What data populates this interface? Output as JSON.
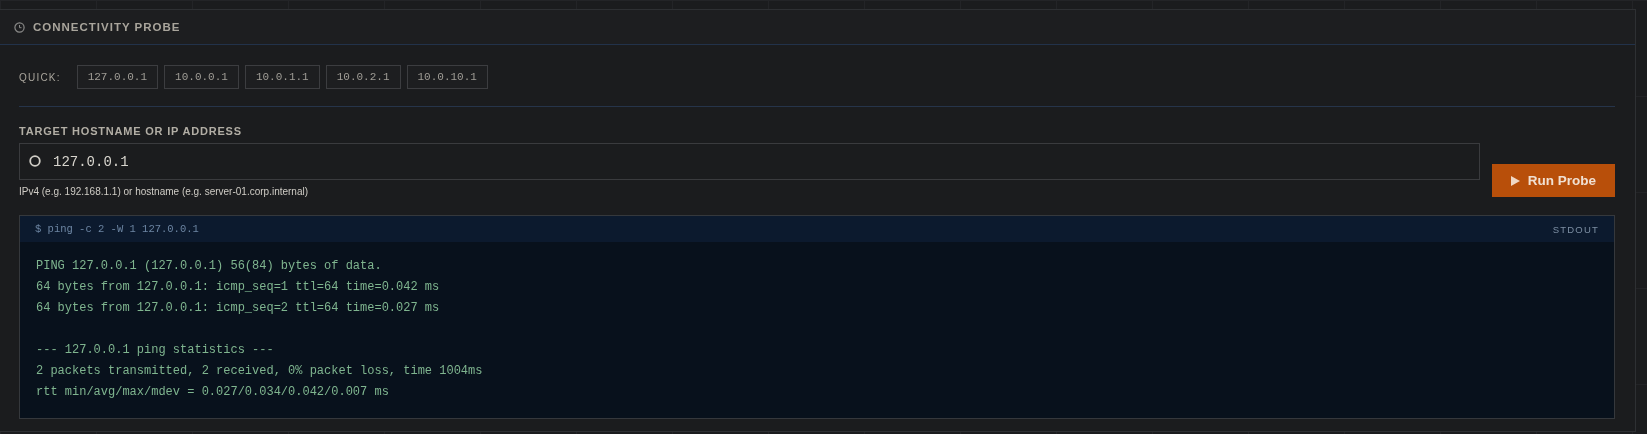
{
  "panel": {
    "title": "CONNECTIVITY PROBE"
  },
  "quick": {
    "label": "QUICK:",
    "hosts": [
      "127.0.0.1",
      "10.0.0.1",
      "10.0.1.1",
      "10.0.2.1",
      "10.0.10.1"
    ]
  },
  "target": {
    "label": "TARGET HOSTNAME OR IP ADDRESS",
    "value": "127.0.0.1",
    "hint": "IPv4 (e.g. 192.168.1.1) or hostname (e.g. server-01.corp.internal)"
  },
  "run_button": {
    "label": "Run Probe"
  },
  "output": {
    "command": "$ ping -c 2 -W 1 127.0.0.1",
    "stream": "STDOUT",
    "blocks": [
      [
        "PING 127.0.0.1 (127.0.0.1) 56(84) bytes of data.",
        "64 bytes from 127.0.0.1: icmp_seq=1 ttl=64 time=0.042 ms",
        "64 bytes from 127.0.0.1: icmp_seq=2 ttl=64 time=0.027 ms"
      ],
      [
        "--- 127.0.0.1 ping statistics ---",
        "2 packets transmitted, 2 received, 0% packet loss, time 1004ms",
        "rtt min/avg/max/mdev = 0.027/0.034/0.042/0.007 ms"
      ]
    ]
  }
}
